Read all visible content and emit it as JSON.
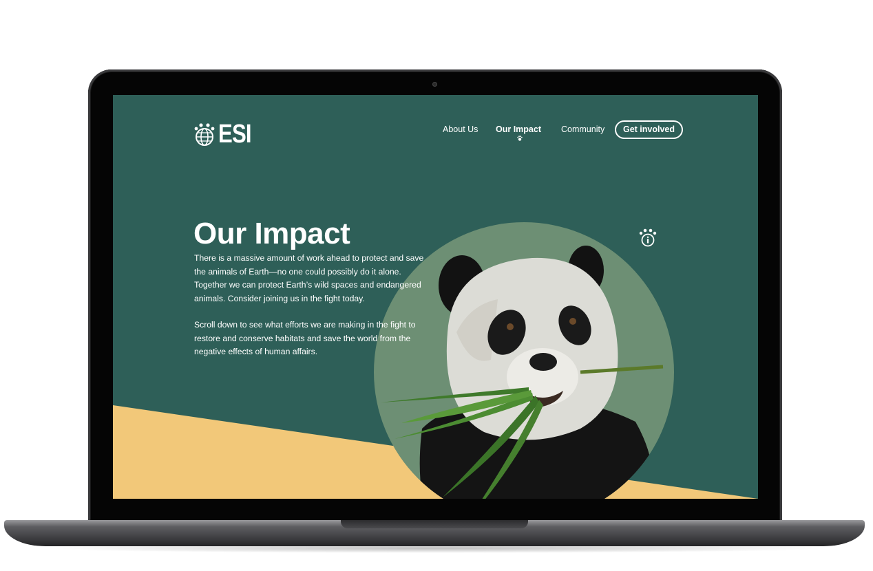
{
  "site": {
    "logo_text": "ESI",
    "nav": {
      "links": [
        "About Us",
        "Our Impact",
        "Community"
      ],
      "active": "Our Impact",
      "cta": "Get involved"
    }
  },
  "hero": {
    "title": "Our Impact",
    "paragraph1": "There is a massive amount of work ahead to protect and save the animals of Earth—no one could possibly do it alone. Together we can protect Earth’s wild spaces and endangered animals. Consider joining us in the fight today.",
    "paragraph2": "Scroll down to see what efforts we are making in the fight to restore and conserve habitats and save the world from the negative effects of human affairs."
  },
  "icons": {
    "logo": "paw-globe-icon",
    "active_indicator": "paw-icon",
    "info": "paw-info-icon"
  },
  "colors": {
    "background": "#2e5f58",
    "circle": "#6d8f74",
    "accent_yellow": "#f2c879",
    "text": "#ffffff"
  }
}
